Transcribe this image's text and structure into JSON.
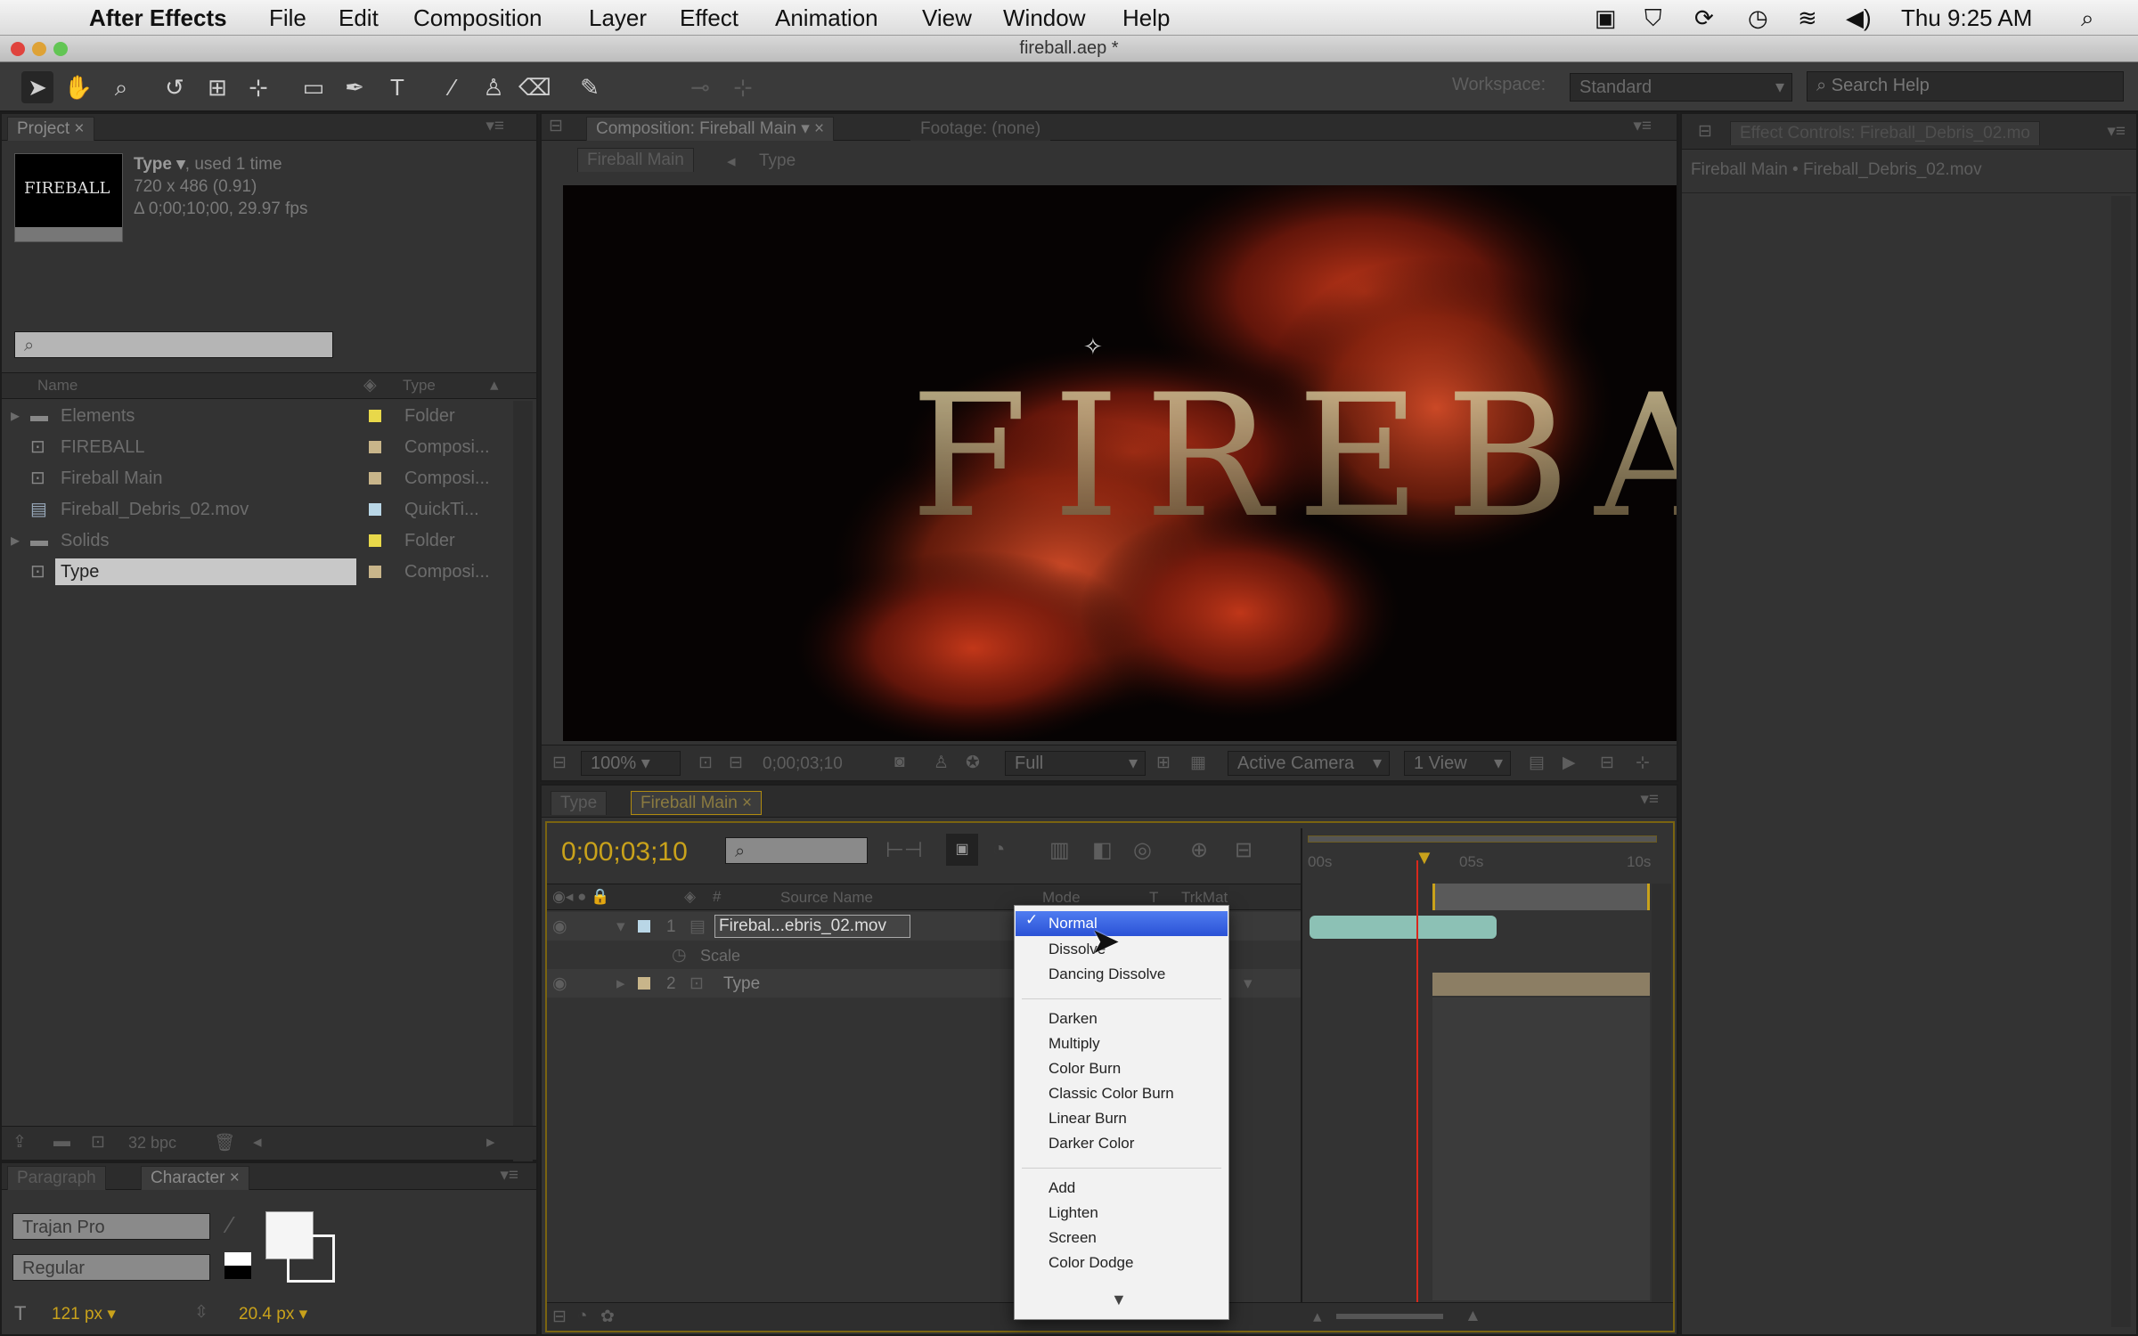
{
  "menubar": {
    "app_name": "After Effects",
    "items": [
      "File",
      "Edit",
      "Composition",
      "Layer",
      "Effect",
      "Animation",
      "View",
      "Window",
      "Help"
    ],
    "clock": "Thu 9:25 AM"
  },
  "window": {
    "title": "fireball.aep *"
  },
  "toolbar": {
    "workspace_label": "Workspace:",
    "workspace_value": "Standard",
    "search_placeholder": "Search Help"
  },
  "project": {
    "tab": "Project",
    "thumb_text": "FIREBALL",
    "info_name": "Type ▾",
    "info_used": ", used 1 time",
    "info_size": "720 x 486 (0.91)",
    "info_duration": "Δ 0;00;10;00, 29.97 fps",
    "col_name": "Name",
    "col_type": "Type",
    "items": [
      {
        "name": "Elements",
        "type": "Folder",
        "color": "#e8d84a"
      },
      {
        "name": "FIREBALL",
        "type": "Composi...",
        "color": "#c8b58a"
      },
      {
        "name": "Fireball Main",
        "type": "Composi...",
        "color": "#c8b58a"
      },
      {
        "name": "Fireball_Debris_02.mov",
        "type": "QuickTi...",
        "color": "#b9d6e6"
      },
      {
        "name": "Solids",
        "type": "Folder",
        "color": "#e8d84a"
      },
      {
        "name": "Type",
        "type": "Composi...",
        "color": "#c8b58a"
      }
    ],
    "bpc": "32 bpc"
  },
  "character": {
    "tab_paragraph": "Paragraph",
    "tab_character": "Character",
    "font": "Trajan Pro",
    "style": "Regular",
    "size": "121 px ▾",
    "leading": "20.4 px ▾"
  },
  "composition": {
    "tab": "Composition: Fireball Main",
    "tab_footage": "Footage: (none)",
    "crumb1": "Fireball Main",
    "crumb2": "Type",
    "zoom": "100%",
    "timecode": "0;00;03;10",
    "resolution": "Full",
    "camera": "Active Camera",
    "views": "1 View",
    "title_text": "FIREBALL"
  },
  "effects": {
    "tab": "Effect Controls: Fireball_Debris_02.mo",
    "path": "Fireball Main • Fireball_Debris_02.mov"
  },
  "timeline": {
    "tab1": "Type",
    "tab2": "Fireball Main",
    "timecode": "0;00;03;10",
    "col_source": "Source Name",
    "col_mode": "Mode",
    "col_t": "T",
    "col_trkmat": "TrkMat",
    "ruler": [
      "00s",
      "05s",
      "10s"
    ],
    "layers": [
      {
        "num": "1",
        "name": "Firebal...ebris_02.mov"
      },
      {
        "num": "2",
        "name": "Type"
      }
    ],
    "sub_property": "Scale"
  },
  "blend_menu": {
    "selected": "Normal",
    "items_group1": [
      "Normal",
      "Dissolve",
      "Dancing Dissolve"
    ],
    "items_group2": [
      "Darken",
      "Multiply",
      "Color Burn",
      "Classic Color Burn",
      "Linear Burn",
      "Darker Color"
    ],
    "items_group3": [
      "Add",
      "Lighten",
      "Screen",
      "Color Dodge"
    ]
  }
}
